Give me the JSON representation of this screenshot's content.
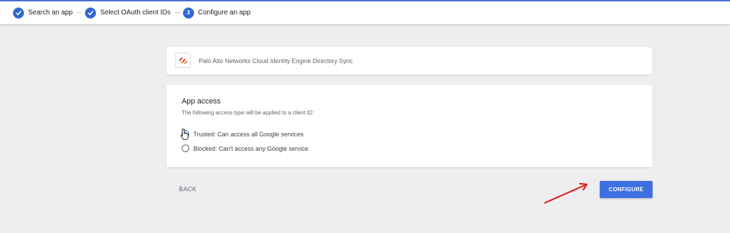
{
  "stepper": {
    "steps": [
      {
        "label": "Search an app",
        "state": "done"
      },
      {
        "label": "Select OAuth client IDs",
        "state": "done"
      },
      {
        "label": "Configure an app",
        "state": "current",
        "number": "3"
      }
    ]
  },
  "app": {
    "name": "Palo Alto Networks Cloud Identity Engine Directory Sync",
    "logo_icon": "palo-alto-networks-logo"
  },
  "access": {
    "title": "App access",
    "description": "The following access type will be applied to a client ID:",
    "options": [
      {
        "label": "Trusted: Can access all Google services",
        "selected": true
      },
      {
        "label": "Blocked: Can't access any Google service",
        "selected": false
      }
    ]
  },
  "actions": {
    "back_label": "BACK",
    "configure_label": "CONFIGURE"
  },
  "colors": {
    "accent": "#3d6fe0",
    "annotation_arrow": "#e0201c",
    "logo": "#e0492c"
  }
}
